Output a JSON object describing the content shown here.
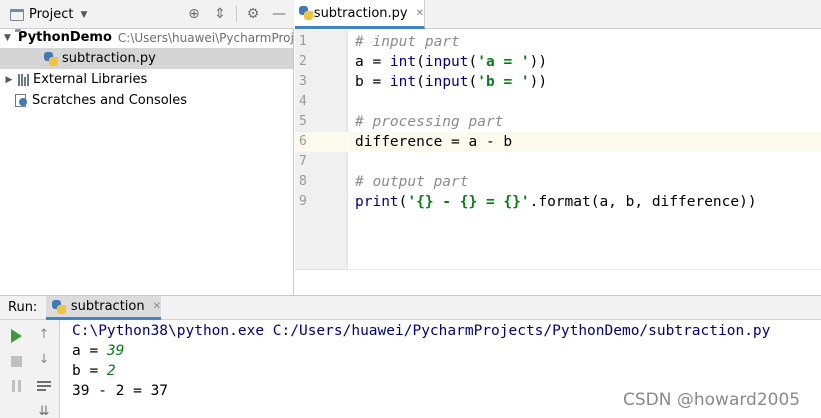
{
  "project_panel": {
    "title": "Project",
    "tree": [
      {
        "label": "PythonDemo",
        "hint": "C:\\Users\\huawei\\PycharmProjects\\PythonDemo"
      },
      {
        "label": "subtraction.py"
      },
      {
        "label": "External Libraries"
      },
      {
        "label": "Scratches and Consoles"
      }
    ]
  },
  "editor": {
    "tab_label": "subtraction.py",
    "line_numbers": [
      "1",
      "2",
      "3",
      "4",
      "5",
      "6",
      "7",
      "8",
      "9"
    ],
    "current_line": 6,
    "lines": {
      "l1": "# input part",
      "l2_a": "a = ",
      "l2_fn1": "int",
      "l2_b": "(",
      "l2_fn2": "input",
      "l2_c": "(",
      "l2_str": "'a = '",
      "l2_d": "))",
      "l3_a": "b = ",
      "l3_fn1": "int",
      "l3_b": "(",
      "l3_fn2": "input",
      "l3_c": "(",
      "l3_str": "'b = '",
      "l3_d": "))",
      "l5": "# processing part",
      "l6": "difference = a - b",
      "l8": "# output part",
      "l9_fn": "print",
      "l9_a": "(",
      "l9_str": "'{} - {} = {}'",
      "l9_b": ".format(a, b, difference))"
    }
  },
  "run_panel": {
    "label": "Run:",
    "tab_label": "subtraction",
    "console": {
      "cmd": "C:\\Python38\\python.exe C:/Users/huawei/PycharmProjects/PythonDemo/subtraction.py",
      "prompt_a": "a = ",
      "input_a": "39",
      "prompt_b": "b = ",
      "input_b": "2",
      "result": "39 - 2 = 37"
    }
  },
  "watermark": "CSDN @howard2005",
  "colors": {
    "accent": "#4083c9",
    "keyword": "#000080",
    "string": "#067d17",
    "comment": "#8c8c8c",
    "current_line": "#fcfaed",
    "play": "#3b9a3b"
  }
}
